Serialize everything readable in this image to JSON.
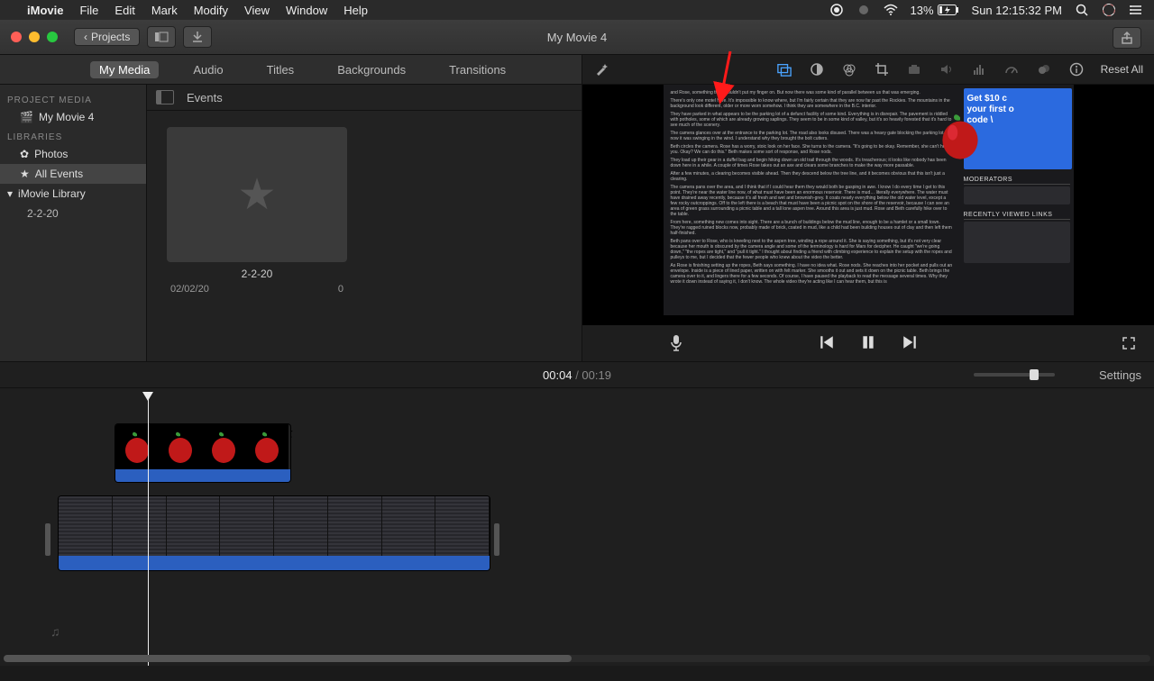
{
  "menubar": {
    "app": "iMovie",
    "items": [
      "File",
      "Edit",
      "Mark",
      "Modify",
      "View",
      "Window",
      "Help"
    ],
    "battery": "13%",
    "battery_icon_state": "charging",
    "clock": "Sun 12:15:32 PM"
  },
  "titlebar": {
    "back_label": "Projects",
    "title": "My Movie 4"
  },
  "tabs": {
    "my_media": "My Media",
    "audio": "Audio",
    "titles": "Titles",
    "backgrounds": "Backgrounds",
    "transitions": "Transitions",
    "active": "my_media"
  },
  "sidebar": {
    "project_media_hdr": "PROJECT MEDIA",
    "project_name": "My Movie 4",
    "libraries_hdr": "LIBRARIES",
    "photos": "Photos",
    "all_events": "All Events",
    "imovie_library": "iMovie Library",
    "library_child": "2-2-20"
  },
  "events": {
    "header_label": "Events",
    "item_name": "2-2-20",
    "item_date": "02/02/20",
    "item_count": "0"
  },
  "right_toolbar": {
    "reset_label": "Reset All",
    "icons": [
      "enhance",
      "overlay",
      "color-balance",
      "color-correction",
      "crop",
      "stabilize",
      "volume",
      "noise",
      "speed",
      "effects",
      "info"
    ]
  },
  "preview": {
    "ad_line1": "Get $10 c",
    "ad_line2": "your first o",
    "ad_line3": "code \\",
    "moderators_hdr": "MODERATORS",
    "recently_viewed_hdr": "RECENTLY VIEWED LINKS"
  },
  "playbar": {
    "state": "playing"
  },
  "timeline_header": {
    "current": "00:04",
    "total": "00:19",
    "settings": "Settings"
  }
}
